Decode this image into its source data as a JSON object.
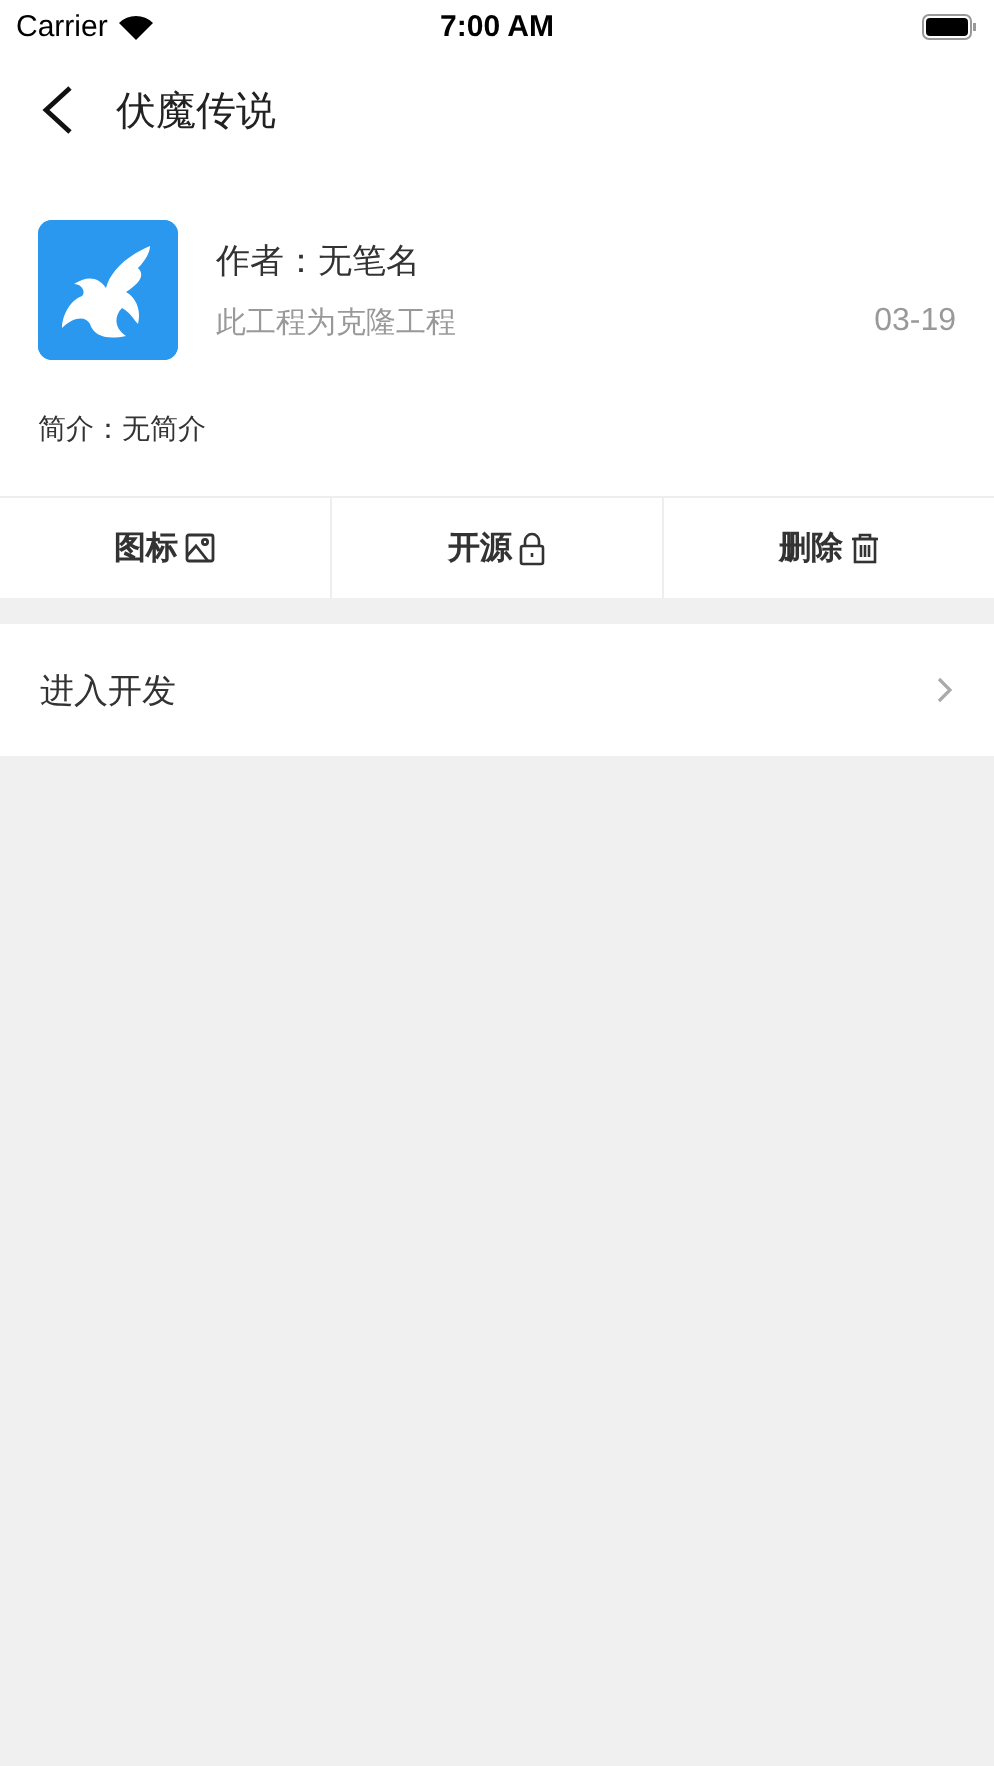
{
  "status_bar": {
    "carrier": "Carrier",
    "time": "7:00 AM"
  },
  "nav": {
    "title": "伏魔传说"
  },
  "project": {
    "author": "作者：无笔名",
    "note": "此工程为克隆工程",
    "date": "03-19",
    "intro": "简介：无简介"
  },
  "actions": [
    {
      "label": "图标",
      "kind": "image"
    },
    {
      "label": "开源",
      "kind": "lock"
    },
    {
      "label": "删除",
      "kind": "trash"
    }
  ],
  "menu": [
    {
      "label": "进入开发"
    }
  ]
}
